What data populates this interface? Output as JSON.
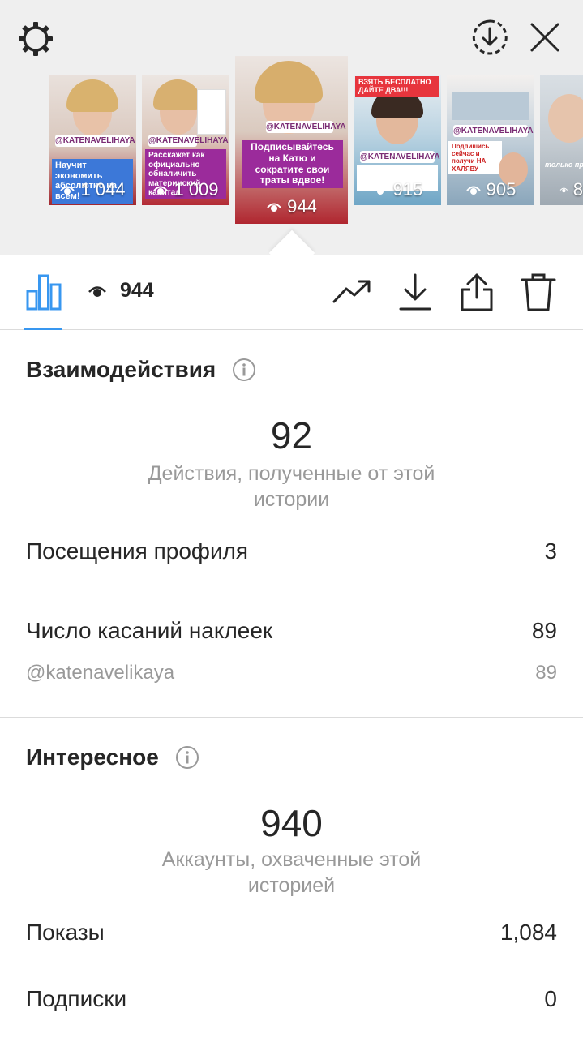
{
  "top": {
    "icons": [
      "gear-icon",
      "download-circle-icon",
      "close-icon"
    ],
    "stories": [
      {
        "views": "1 044",
        "banner": "Научит экономить абсолютно на всём!",
        "tag": "@KATENAVELIHAYA"
      },
      {
        "views": "1 009",
        "banner": "Расскажет как официально обналичить материнский капитал",
        "tag": "@KATENAVELIHAYA"
      },
      {
        "views": "944",
        "banner": "Подписывайтесь на Катю и сократите свои траты вдвое!",
        "tag": "@KATENAVELIHAYA"
      },
      {
        "views": "915",
        "banner": "ВЗЯТЬ БЕСПЛАТНО ДАЙТЕ ДВА!!!",
        "tag": "@KATENAVELIHAYA"
      },
      {
        "views": "905",
        "banner": "Подпишись сейчас и получи НА ХАЛЯВУ",
        "tag": "@KATENAVELIHAYA"
      },
      {
        "views": "8",
        "banner": "только про",
        "tag": ""
      }
    ]
  },
  "toolbar": {
    "views": "944",
    "icons": [
      "bar-chart-icon",
      "eye-icon",
      "trend-icon",
      "download-icon",
      "share-icon",
      "trash-icon"
    ]
  },
  "interactions": {
    "title": "Взаимодействия",
    "total": "92",
    "total_caption": "Действия, полученные от этой истории",
    "rows": [
      {
        "label": "Посещения профиля",
        "value": "3"
      },
      {
        "label": "Число касаний наклеек",
        "value": "89"
      }
    ],
    "sub_row": {
      "label": "@katenavelikaya",
      "value": "89"
    }
  },
  "discovery": {
    "title": "Интересное",
    "total": "940",
    "total_caption": "Аккаунты, охваченные этой историей",
    "rows": [
      {
        "label": "Показы",
        "value": "1,084"
      },
      {
        "label": "Подписки",
        "value": "0"
      }
    ]
  },
  "colors": {
    "accent": "#3897f0",
    "text": "#262626",
    "secondary": "#999999",
    "banner_blue": "#3c78d8",
    "banner_purple": "#9b2b9b"
  }
}
